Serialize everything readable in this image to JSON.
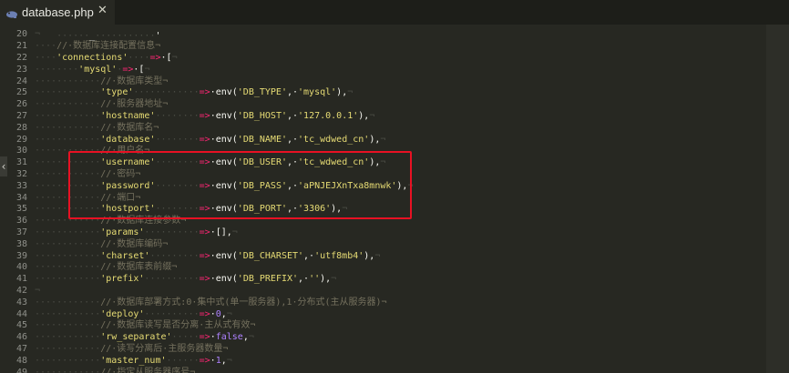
{
  "tab": {
    "title": "database.php",
    "close": "✕",
    "icon": "php-file-icon"
  },
  "colors": {
    "background": "#272822",
    "string": "#e6db74",
    "operator": "#f92672",
    "comment": "#75715e",
    "keyword": "#ae81ff",
    "highlight_border": "#e81123"
  },
  "editor": {
    "lines": [
      {
        "num": "20",
        "segments": [
          {
            "t": "¬",
            "c": "pil"
          }
        ]
      },
      {
        "num": "21",
        "segments": [
          {
            "t": "····",
            "c": "ind"
          },
          {
            "t": "//·数据库连接配置信息¬",
            "c": "cm"
          }
        ]
      },
      {
        "num": "22",
        "segments": [
          {
            "t": "····",
            "c": "ind"
          },
          {
            "t": "'connections'",
            "c": "str"
          },
          {
            "t": "····",
            "c": "ind"
          },
          {
            "t": "=>",
            "c": "op"
          },
          {
            "t": "·[",
            "c": "pl"
          },
          {
            "t": "¬",
            "c": "pil"
          }
        ]
      },
      {
        "num": "23",
        "segments": [
          {
            "t": "········",
            "c": "ind"
          },
          {
            "t": "'mysql'",
            "c": "str"
          },
          {
            "t": "·",
            "c": "ind"
          },
          {
            "t": "=>",
            "c": "op"
          },
          {
            "t": "·[",
            "c": "pl"
          },
          {
            "t": "¬",
            "c": "pil"
          }
        ]
      },
      {
        "num": "24",
        "segments": [
          {
            "t": "············",
            "c": "ind"
          },
          {
            "t": "//·数据库类型¬",
            "c": "cm"
          }
        ]
      },
      {
        "num": "25",
        "segments": [
          {
            "t": "············",
            "c": "ind"
          },
          {
            "t": "'type'",
            "c": "str"
          },
          {
            "t": "············",
            "c": "ind"
          },
          {
            "t": "=>",
            "c": "op"
          },
          {
            "t": "·env(",
            "c": "fn"
          },
          {
            "t": "'DB_TYPE'",
            "c": "str"
          },
          {
            "t": ",·",
            "c": "pl"
          },
          {
            "t": "'mysql'",
            "c": "str"
          },
          {
            "t": "),",
            "c": "pl"
          },
          {
            "t": "¬",
            "c": "pil"
          }
        ]
      },
      {
        "num": "26",
        "segments": [
          {
            "t": "············",
            "c": "ind"
          },
          {
            "t": "//·服务器地址¬",
            "c": "cm"
          }
        ]
      },
      {
        "num": "27",
        "segments": [
          {
            "t": "············",
            "c": "ind"
          },
          {
            "t": "'hostname'",
            "c": "str"
          },
          {
            "t": "········",
            "c": "ind"
          },
          {
            "t": "=>",
            "c": "op"
          },
          {
            "t": "·env(",
            "c": "fn"
          },
          {
            "t": "'DB_HOST'",
            "c": "str"
          },
          {
            "t": ",·",
            "c": "pl"
          },
          {
            "t": "'127.0.0.1'",
            "c": "str"
          },
          {
            "t": "),",
            "c": "pl"
          },
          {
            "t": "¬",
            "c": "pil"
          }
        ]
      },
      {
        "num": "28",
        "segments": [
          {
            "t": "············",
            "c": "ind"
          },
          {
            "t": "//·数据库名¬",
            "c": "cm"
          }
        ]
      },
      {
        "num": "29",
        "segments": [
          {
            "t": "············",
            "c": "ind"
          },
          {
            "t": "'database'",
            "c": "str"
          },
          {
            "t": "········",
            "c": "ind"
          },
          {
            "t": "=>",
            "c": "op"
          },
          {
            "t": "·env(",
            "c": "fn"
          },
          {
            "t": "'DB_NAME'",
            "c": "str"
          },
          {
            "t": ",·",
            "c": "pl"
          },
          {
            "t": "'tc_wdwed_cn'",
            "c": "str"
          },
          {
            "t": "),",
            "c": "pl"
          },
          {
            "t": "¬",
            "c": "pil"
          }
        ]
      },
      {
        "num": "30",
        "segments": [
          {
            "t": "············",
            "c": "ind"
          },
          {
            "t": "//·用户名¬",
            "c": "cm"
          }
        ]
      },
      {
        "num": "31",
        "segments": [
          {
            "t": "············",
            "c": "ind"
          },
          {
            "t": "'username'",
            "c": "str"
          },
          {
            "t": "········",
            "c": "ind"
          },
          {
            "t": "=>",
            "c": "op"
          },
          {
            "t": "·env(",
            "c": "fn"
          },
          {
            "t": "'DB_USER'",
            "c": "str"
          },
          {
            "t": ",·",
            "c": "pl"
          },
          {
            "t": "'tc_wdwed_cn'",
            "c": "str"
          },
          {
            "t": "),",
            "c": "pl"
          },
          {
            "t": "¬",
            "c": "pil"
          }
        ]
      },
      {
        "num": "32",
        "segments": [
          {
            "t": "············",
            "c": "ind"
          },
          {
            "t": "//·密码¬",
            "c": "cm"
          }
        ]
      },
      {
        "num": "33",
        "segments": [
          {
            "t": "············",
            "c": "ind"
          },
          {
            "t": "'password'",
            "c": "str"
          },
          {
            "t": "········",
            "c": "ind"
          },
          {
            "t": "=>",
            "c": "op"
          },
          {
            "t": "·env(",
            "c": "fn"
          },
          {
            "t": "'DB_PASS'",
            "c": "str"
          },
          {
            "t": ",·",
            "c": "pl"
          },
          {
            "t": "'aPNJEJXnTxa8mnwk'",
            "c": "str"
          },
          {
            "t": "),",
            "c": "pl"
          },
          {
            "t": "¬",
            "c": "pil"
          }
        ]
      },
      {
        "num": "34",
        "segments": [
          {
            "t": "············",
            "c": "ind"
          },
          {
            "t": "//·端口¬",
            "c": "cm"
          }
        ]
      },
      {
        "num": "35",
        "segments": [
          {
            "t": "············",
            "c": "ind"
          },
          {
            "t": "'hostport'",
            "c": "str"
          },
          {
            "t": "········",
            "c": "ind"
          },
          {
            "t": "=>",
            "c": "op"
          },
          {
            "t": "·env(",
            "c": "fn"
          },
          {
            "t": "'DB_PORT'",
            "c": "str"
          },
          {
            "t": ",·",
            "c": "pl"
          },
          {
            "t": "'3306'",
            "c": "str"
          },
          {
            "t": "),",
            "c": "pl"
          },
          {
            "t": "¬",
            "c": "pil"
          }
        ]
      },
      {
        "num": "36",
        "segments": [
          {
            "t": "············",
            "c": "ind"
          },
          {
            "t": "//·数据库连接参数¬",
            "c": "cm"
          }
        ]
      },
      {
        "num": "37",
        "segments": [
          {
            "t": "············",
            "c": "ind"
          },
          {
            "t": "'params'",
            "c": "str"
          },
          {
            "t": "··········",
            "c": "ind"
          },
          {
            "t": "=>",
            "c": "op"
          },
          {
            "t": "·[],",
            "c": "pl"
          },
          {
            "t": "¬",
            "c": "pil"
          }
        ]
      },
      {
        "num": "38",
        "segments": [
          {
            "t": "············",
            "c": "ind"
          },
          {
            "t": "//·数据库编码¬",
            "c": "cm"
          }
        ]
      },
      {
        "num": "39",
        "segments": [
          {
            "t": "············",
            "c": "ind"
          },
          {
            "t": "'charset'",
            "c": "str"
          },
          {
            "t": "·········",
            "c": "ind"
          },
          {
            "t": "=>",
            "c": "op"
          },
          {
            "t": "·env(",
            "c": "fn"
          },
          {
            "t": "'DB_CHARSET'",
            "c": "str"
          },
          {
            "t": ",·",
            "c": "pl"
          },
          {
            "t": "'utf8mb4'",
            "c": "str"
          },
          {
            "t": "),",
            "c": "pl"
          },
          {
            "t": "¬",
            "c": "pil"
          }
        ]
      },
      {
        "num": "40",
        "segments": [
          {
            "t": "············",
            "c": "ind"
          },
          {
            "t": "//·数据库表前缀¬",
            "c": "cm"
          }
        ]
      },
      {
        "num": "41",
        "segments": [
          {
            "t": "············",
            "c": "ind"
          },
          {
            "t": "'prefix'",
            "c": "str"
          },
          {
            "t": "··········",
            "c": "ind"
          },
          {
            "t": "=>",
            "c": "op"
          },
          {
            "t": "·env(",
            "c": "fn"
          },
          {
            "t": "'DB_PREFIX'",
            "c": "str"
          },
          {
            "t": ",·",
            "c": "pl"
          },
          {
            "t": "''",
            "c": "str"
          },
          {
            "t": "),",
            "c": "pl"
          },
          {
            "t": "¬",
            "c": "pil"
          }
        ]
      },
      {
        "num": "42",
        "segments": [
          {
            "t": "¬",
            "c": "pil"
          }
        ]
      },
      {
        "num": "43",
        "segments": [
          {
            "t": "············",
            "c": "ind"
          },
          {
            "t": "//·数据库部署方式:0·集中式(单一服务器),1·分布式(主从服务器)¬",
            "c": "cm"
          }
        ]
      },
      {
        "num": "44",
        "segments": [
          {
            "t": "············",
            "c": "ind"
          },
          {
            "t": "'deploy'",
            "c": "str"
          },
          {
            "t": "··········",
            "c": "ind"
          },
          {
            "t": "=>",
            "c": "op"
          },
          {
            "t": "·",
            "c": "pl"
          },
          {
            "t": "0",
            "c": "kw"
          },
          {
            "t": ",",
            "c": "pl"
          },
          {
            "t": "¬",
            "c": "pil"
          }
        ]
      },
      {
        "num": "45",
        "segments": [
          {
            "t": "············",
            "c": "ind"
          },
          {
            "t": "//·数据库读写是否分离·主从式有效¬",
            "c": "cm"
          }
        ]
      },
      {
        "num": "46",
        "segments": [
          {
            "t": "············",
            "c": "ind"
          },
          {
            "t": "'rw_separate'",
            "c": "str"
          },
          {
            "t": "·····",
            "c": "ind"
          },
          {
            "t": "=>",
            "c": "op"
          },
          {
            "t": "·",
            "c": "pl"
          },
          {
            "t": "false",
            "c": "kw"
          },
          {
            "t": ",",
            "c": "pl"
          },
          {
            "t": "¬",
            "c": "pil"
          }
        ]
      },
      {
        "num": "47",
        "segments": [
          {
            "t": "············",
            "c": "ind"
          },
          {
            "t": "//·读写分离后·主服务器数量¬",
            "c": "cm"
          }
        ]
      },
      {
        "num": "48",
        "segments": [
          {
            "t": "············",
            "c": "ind"
          },
          {
            "t": "'master_num'",
            "c": "str"
          },
          {
            "t": "······",
            "c": "ind"
          },
          {
            "t": "=>",
            "c": "op"
          },
          {
            "t": "·",
            "c": "pl"
          },
          {
            "t": "1",
            "c": "kw"
          },
          {
            "t": ",",
            "c": "pl"
          },
          {
            "t": "¬",
            "c": "pil"
          }
        ]
      },
      {
        "num": "49",
        "segments": [
          {
            "t": "············",
            "c": "ind"
          },
          {
            "t": "//·指定从服务器序号¬",
            "c": "cm"
          }
        ]
      }
    ]
  }
}
